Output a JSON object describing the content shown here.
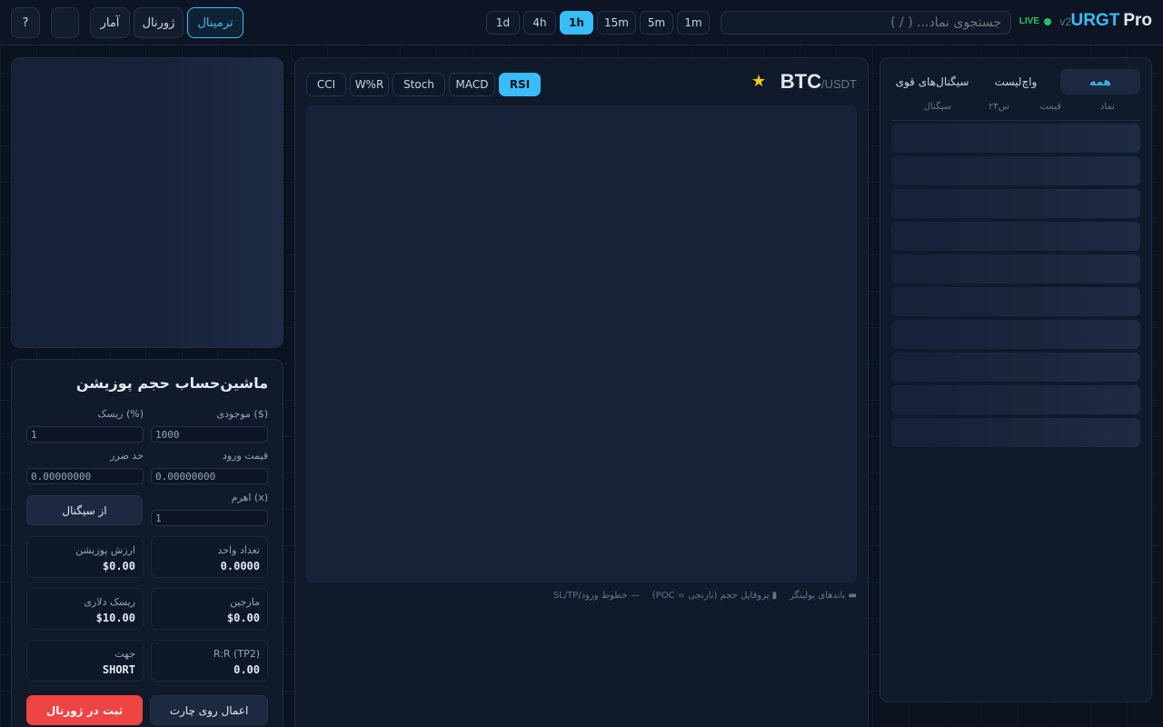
{
  "header": {
    "brand": {
      "name": "URGT",
      "suffix": "Pro",
      "version": "v2"
    },
    "live_label": "LIVE",
    "search_placeholder": "جستجوی نماد... ( / )",
    "timeframes": [
      "1d",
      "4h",
      "1h",
      "15m",
      "5m",
      "1m"
    ],
    "active_timeframe": "1h",
    "nav": {
      "terminal": "ترمینال",
      "journal": "ژورنال",
      "stats": "آمار",
      "help": "?",
      "theme_icon": ""
    }
  },
  "watchlist": {
    "tabs": [
      "همه",
      "واچ‌لیست",
      "سیگنال‌های قوی"
    ],
    "columns": [
      "نماد",
      "قیمت",
      "۲۴س",
      "سیگنال"
    ]
  },
  "chart": {
    "symbol_base": "BTC",
    "symbol_quote": "/USDT",
    "indicators": [
      "RSI",
      "MACD",
      "Stoch",
      "W%R",
      "CCI"
    ],
    "active_indicator": "RSI",
    "legend": [
      "▬ باندهای بولینگر",
      "▮ پروفایل حجم (نارنجی = POC)",
      "— خطوط ورود/SL/TP"
    ]
  },
  "calculator": {
    "title": "ماشین‌حساب حجم پوزیشن",
    "fields": {
      "balance": {
        "label": "موجودی ($)",
        "value": "1000"
      },
      "risk": {
        "label": "ریسک (%)",
        "value": "1"
      },
      "entry": {
        "label": "قیمت ورود",
        "value": "0.00000000"
      },
      "stop": {
        "label": "حد ضرر",
        "value": "0.00000000"
      },
      "leverage": {
        "label": "اهرم (x)",
        "value": "1"
      }
    },
    "from_signal": "از سیگنال",
    "stats": {
      "units": {
        "label": "تعداد واحد",
        "value": "0.0000"
      },
      "position_value": {
        "label": "ارزش پوزیشن",
        "value": "$0.00"
      },
      "margin": {
        "label": "مارجین",
        "value": "$0.00"
      },
      "risk_dollar": {
        "label": "ریسک دلاری",
        "value": "$10.00"
      },
      "rr": {
        "label": "R:R (TP2)",
        "value": "0.00"
      },
      "direction": {
        "label": "جهت",
        "value": "SHORT"
      }
    },
    "apply_button": "اعمال روی چارت",
    "save_button": "ثبت در ژورنال"
  },
  "colors": {
    "accent": "#38bdf8",
    "live": "#22c55e",
    "danger": "#ef4444",
    "star": "#facc15"
  }
}
